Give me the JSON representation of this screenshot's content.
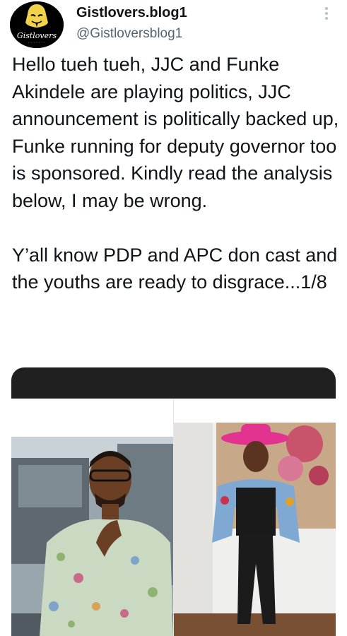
{
  "tweet": {
    "display_name": "Gistlovers.blog1",
    "handle": "@Gistloversblog1",
    "avatar_text": "Gistlovers",
    "text": "Hello tueh tueh, JJC and Funke Akindele are playing politics, JJC announcement is politically backed up, Funke running for deputy governor too is sponsored. Kindly read the analysis below, I may be wrong.\n\nY’all know PDP and APC don cast and the youths are ready to disgrace...1/8"
  },
  "icons": {
    "more": "more-options-icon"
  }
}
